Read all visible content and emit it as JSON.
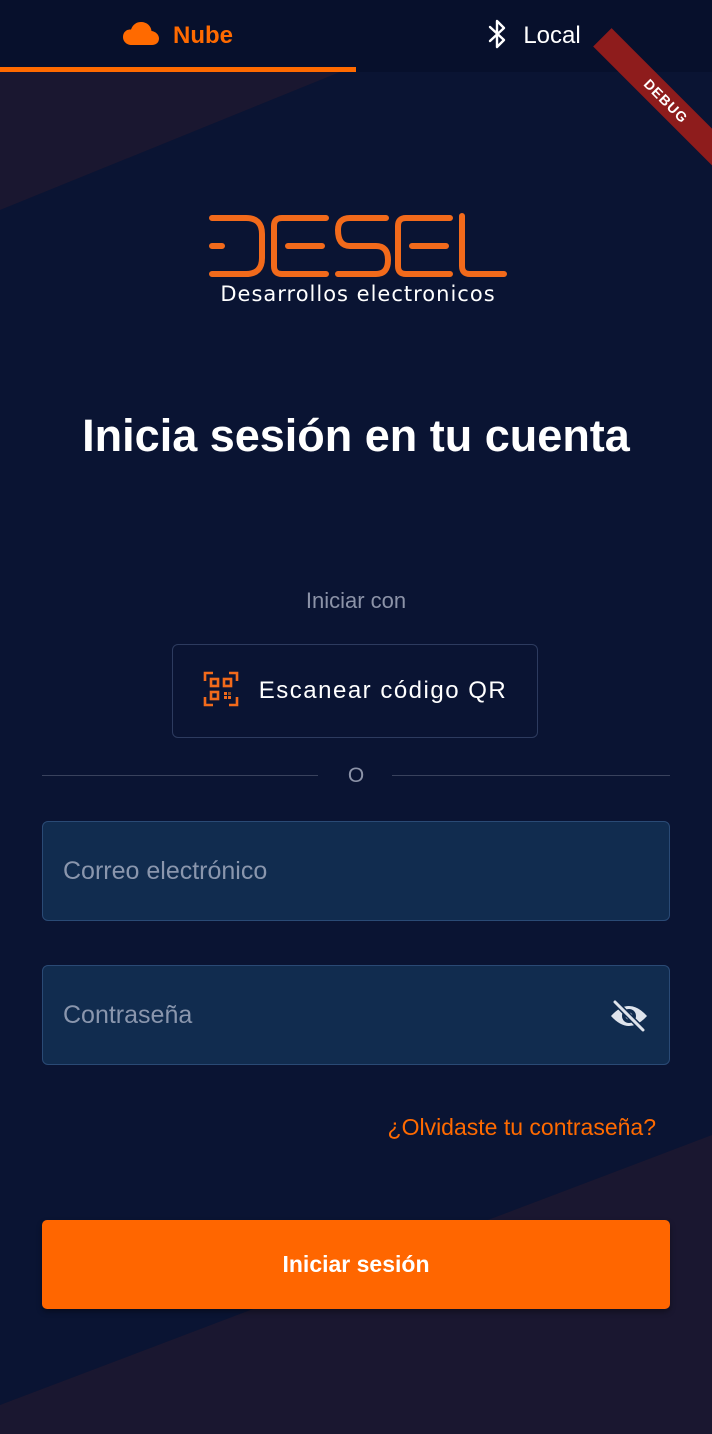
{
  "tabs": [
    {
      "label": "Nube",
      "icon": "cloud-icon",
      "active": true
    },
    {
      "label": "Local",
      "icon": "bluetooth-icon",
      "active": false
    }
  ],
  "debug_banner": "DEBUG",
  "logo": {
    "wordmark": "DESEL",
    "subtitle": "Desarrollos electronicos"
  },
  "title": "Inicia sesión en tu cuenta",
  "login_with_label": "Iniciar con",
  "qr_button": {
    "label": "Escanear código QR",
    "icon": "qr-code-icon"
  },
  "divider_label": "O",
  "email_field": {
    "placeholder": "Correo electrónico",
    "value": ""
  },
  "password_field": {
    "placeholder": "Contraseña",
    "value": "",
    "toggle_icon": "eye-slash-icon"
  },
  "forgot_password": "¿Olvidaste tu contraseña?",
  "login_button": "Iniciar sesión",
  "colors": {
    "accent": "#ff6a00",
    "background": "#0a1433",
    "field_background": "#112c4f",
    "debug_ribbon": "#8e1c1c"
  }
}
